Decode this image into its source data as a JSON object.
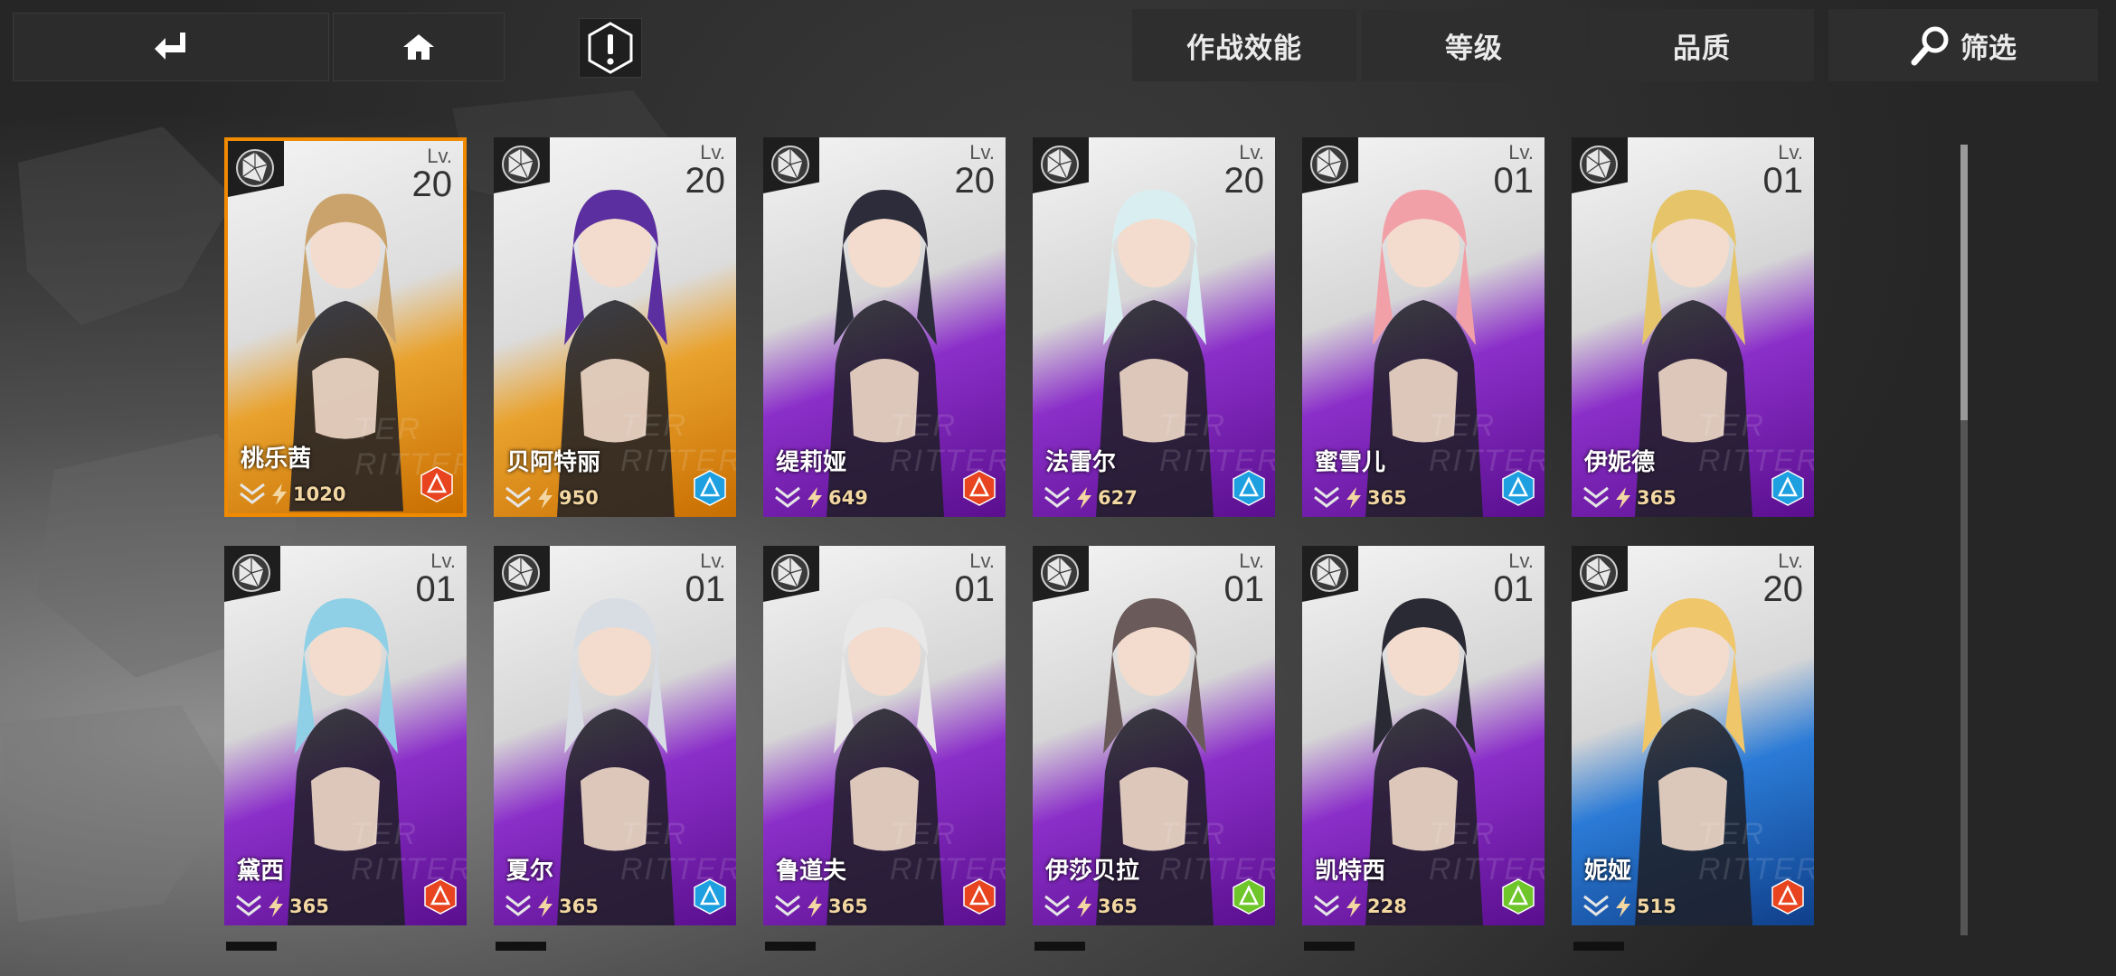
{
  "toolbar": {
    "back_icon": "return-arrow-icon",
    "home_icon": "home-icon",
    "alert_icon": "alert-icon",
    "sort_combat": "作战效能",
    "sort_level": "等级",
    "sort_quality": "品质",
    "filter_label": "筛选",
    "filter_icon": "search-icon"
  },
  "level_label": "Lv.",
  "strip_text": "TER RITTER",
  "colors": {
    "selected_border": "#f08a00",
    "purple": "#9a1fd6",
    "orange": "#f08a00",
    "blue": "#1c6fd1"
  },
  "characters": [
    {
      "name": "桃乐茜",
      "level": "20",
      "power": "1020",
      "element": "red",
      "rarity": "orange",
      "selected": true
    },
    {
      "name": "贝阿特丽",
      "level": "20",
      "power": "950",
      "element": "blue",
      "rarity": "orange",
      "selected": false
    },
    {
      "name": "缇莉娅",
      "level": "20",
      "power": "649",
      "element": "red",
      "rarity": "purple",
      "selected": false
    },
    {
      "name": "法雷尔",
      "level": "20",
      "power": "627",
      "element": "blue",
      "rarity": "purple",
      "selected": false
    },
    {
      "name": "蜜雪儿",
      "level": "01",
      "power": "365",
      "element": "blue",
      "rarity": "purple",
      "selected": false
    },
    {
      "name": "伊妮德",
      "level": "01",
      "power": "365",
      "element": "blue",
      "rarity": "purple",
      "selected": false
    },
    {
      "name": "黛西",
      "level": "01",
      "power": "365",
      "element": "red",
      "rarity": "purple",
      "selected": false
    },
    {
      "name": "夏尔",
      "level": "01",
      "power": "365",
      "element": "blue",
      "rarity": "purple",
      "selected": false
    },
    {
      "name": "鲁道夫",
      "level": "01",
      "power": "365",
      "element": "red",
      "rarity": "purple",
      "selected": false
    },
    {
      "name": "伊莎贝拉",
      "level": "01",
      "power": "365",
      "element": "green",
      "rarity": "purple",
      "selected": false
    },
    {
      "name": "凯特西",
      "level": "01",
      "power": "228",
      "element": "green",
      "rarity": "purple",
      "selected": false
    },
    {
      "name": "妮娅",
      "level": "20",
      "power": "515",
      "element": "red",
      "rarity": "blue",
      "selected": false
    }
  ]
}
